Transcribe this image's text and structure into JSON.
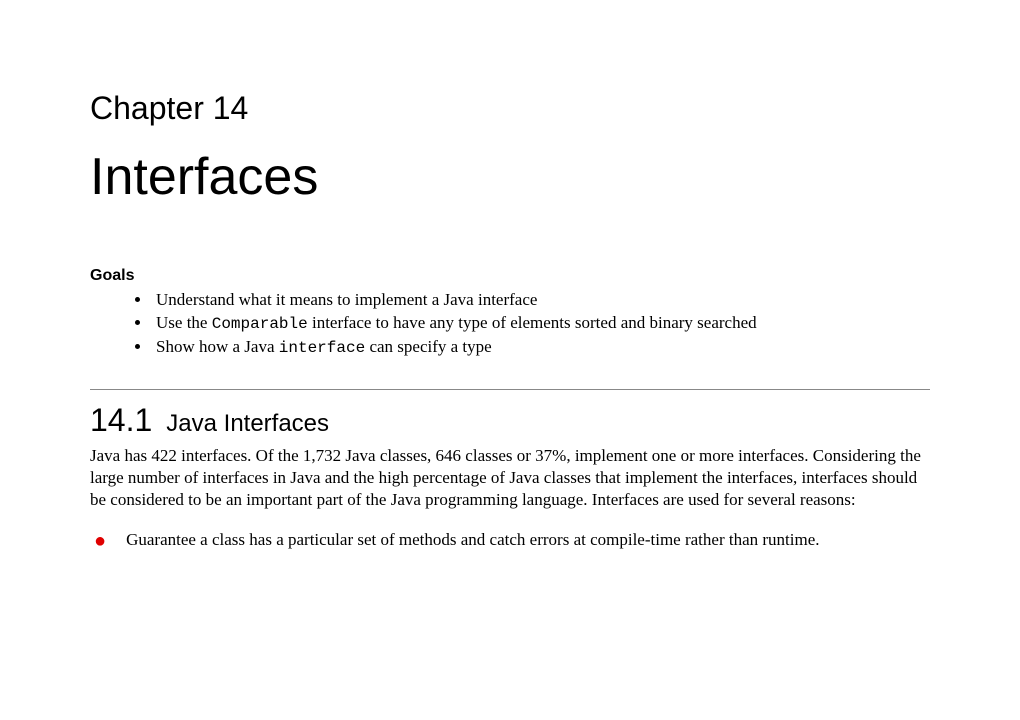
{
  "chapter": {
    "number": "Chapter 14",
    "title": "Interfaces"
  },
  "goals": {
    "label": "Goals",
    "items": [
      {
        "pre": "Understand what it means to implement a Java interface"
      },
      {
        "pre": "Use the ",
        "code": "Comparable",
        "post": " interface to have any type of elements sorted and binary searched"
      },
      {
        "pre": "Show how a Java ",
        "code": "interface",
        "post": " can specify a type"
      }
    ]
  },
  "section": {
    "number": "14.1",
    "title": "Java Interfaces",
    "paragraph": "Java has 422 interfaces. Of the 1,732 Java classes, 646 classes or 37%, implement one or more interfaces. Considering the large number of interfaces in Java and the high percentage of Java classes that implement the interfaces, interfaces should be considered to be an important part of the Java programming language. Interfaces are used for several reasons:",
    "reasons": [
      "Guarantee a class has a particular set of methods and catch errors at compile-time rather than runtime."
    ]
  }
}
